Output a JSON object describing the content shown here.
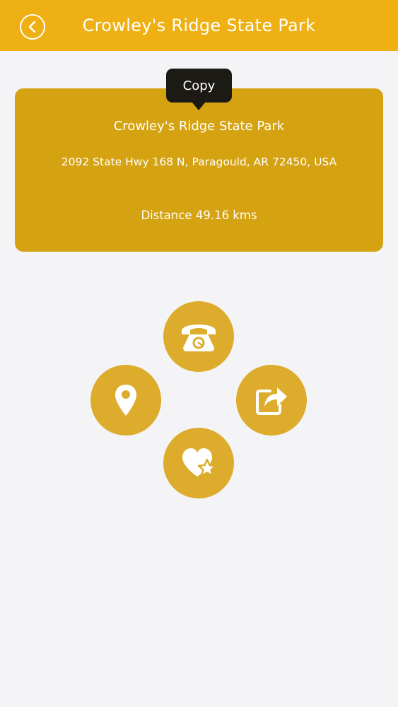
{
  "header": {
    "title": "Crowley's Ridge State Park",
    "back_icon": "chevron-left-icon"
  },
  "tooltip": {
    "label": "Copy"
  },
  "card": {
    "name": "Crowley's Ridge State Park",
    "address": "2092 State Hwy 168 N, Paragould, AR 72450, USA",
    "distance": "Distance 49.16 kms"
  },
  "actions": [
    {
      "id": "call",
      "icon": "telephone-icon"
    },
    {
      "id": "map",
      "icon": "location-pin-icon"
    },
    {
      "id": "share",
      "icon": "share-icon"
    },
    {
      "id": "favorite",
      "icon": "heart-star-icon"
    }
  ],
  "colors": {
    "header": "#eeb013",
    "card": "#d5a212",
    "buttons": "#ddac2d",
    "tooltip": "#1c1a14",
    "background": "#f4f4f6"
  }
}
